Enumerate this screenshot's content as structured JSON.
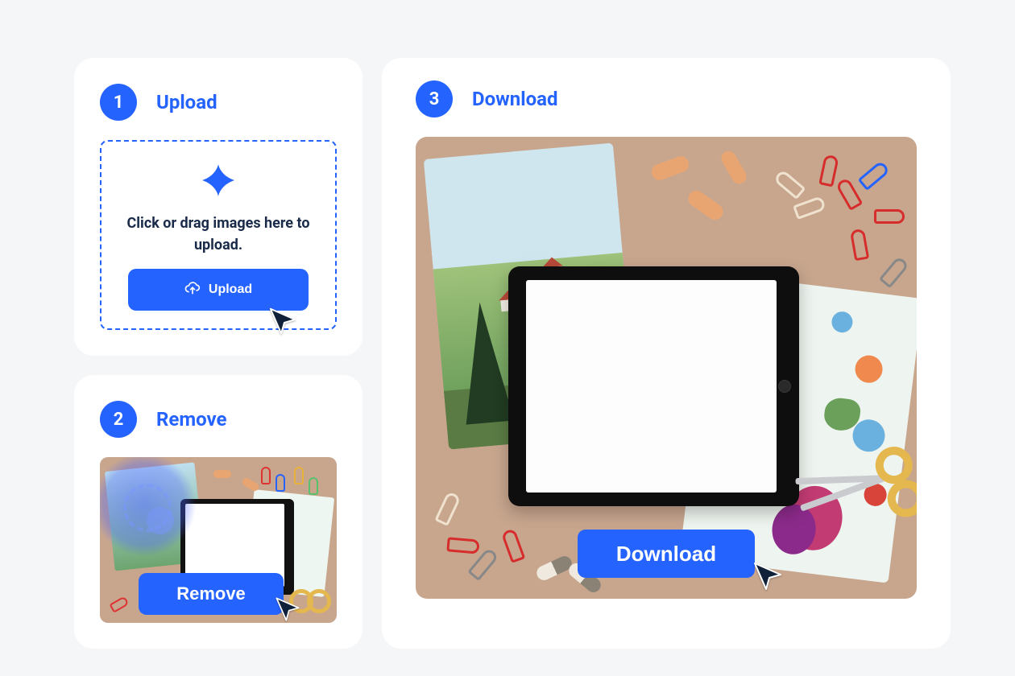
{
  "steps": {
    "upload": {
      "num": "1",
      "title": "Upload"
    },
    "remove": {
      "num": "2",
      "title": "Remove"
    },
    "download": {
      "num": "3",
      "title": "Download"
    }
  },
  "dropzone": {
    "text": "Click or drag images here to upload."
  },
  "buttons": {
    "upload": "Upload",
    "remove": "Remove",
    "download": "Download"
  }
}
